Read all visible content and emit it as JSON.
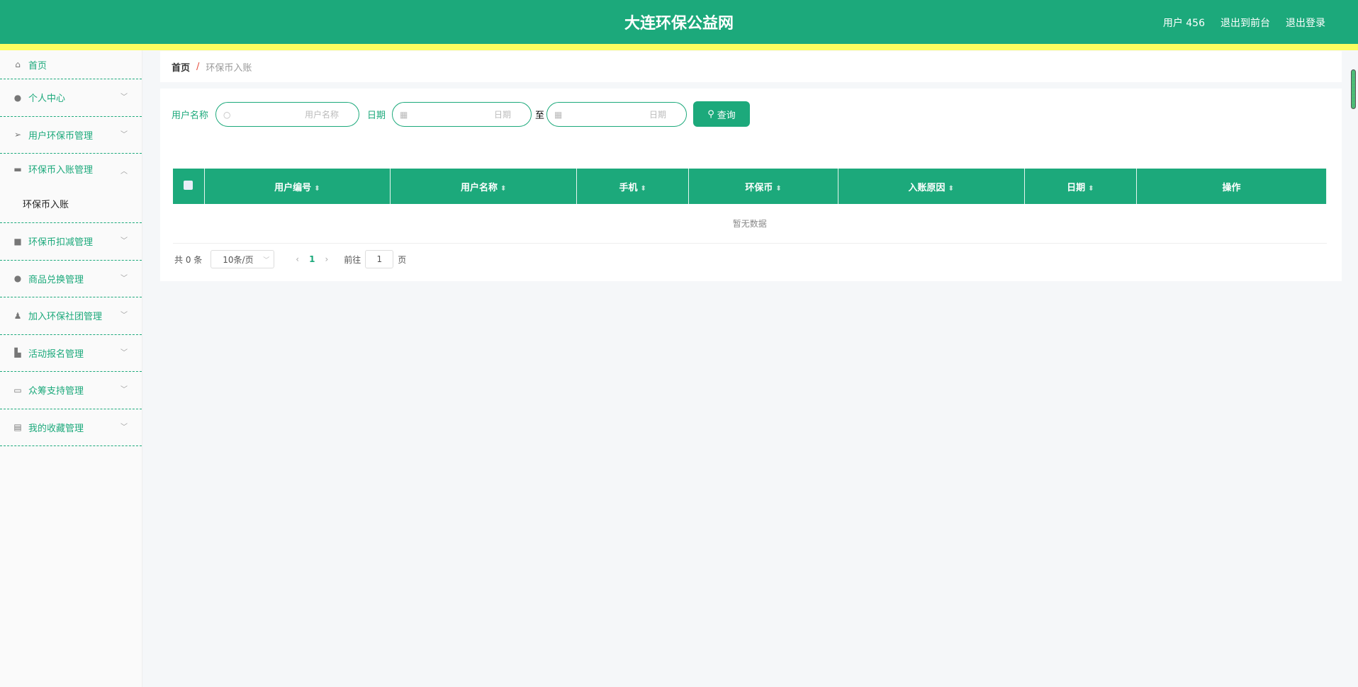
{
  "header": {
    "title": "大连环保公益网",
    "user": "用户 456",
    "to_front": "退出到前台",
    "logout": "退出登录"
  },
  "sidebar": {
    "items": [
      {
        "label": "首页",
        "icon": "home-icon"
      },
      {
        "label": "个人中心",
        "icon": "user-icon"
      },
      {
        "label": "用户环保币管理",
        "icon": "send-icon"
      },
      {
        "label": "环保币入账管理",
        "icon": "ticket-icon",
        "sub": "环保币入账"
      },
      {
        "label": "环保币扣减管理",
        "icon": "inbox-icon"
      },
      {
        "label": "商品兑换管理",
        "icon": "balloon-icon"
      },
      {
        "label": "加入环保社团管理",
        "icon": "stamp-icon"
      },
      {
        "label": "活动报名管理",
        "icon": "flag-icon"
      },
      {
        "label": "众筹支持管理",
        "icon": "chat-icon"
      },
      {
        "label": "我的收藏管理",
        "icon": "card-icon"
      }
    ]
  },
  "breadcrumb": {
    "home": "首页",
    "sep": "/",
    "current": "环保币入账"
  },
  "filters": {
    "username_label": "用户名称",
    "username_placeholder": "用户名称",
    "date_label": "日期",
    "date_placeholder": "日期",
    "to": "至",
    "search": "查询"
  },
  "table": {
    "columns": [
      "用户编号",
      "用户名称",
      "手机",
      "环保币",
      "入账原因",
      "日期",
      "操作"
    ],
    "empty": "暂无数据"
  },
  "pagination": {
    "total": "共 0 条",
    "page_size": "10条/页",
    "current": "1",
    "goto": "前往",
    "goto_value": "1",
    "page_unit": "页"
  },
  "colors": {
    "primary": "#1ca97b",
    "accent": "#fdfd60"
  }
}
